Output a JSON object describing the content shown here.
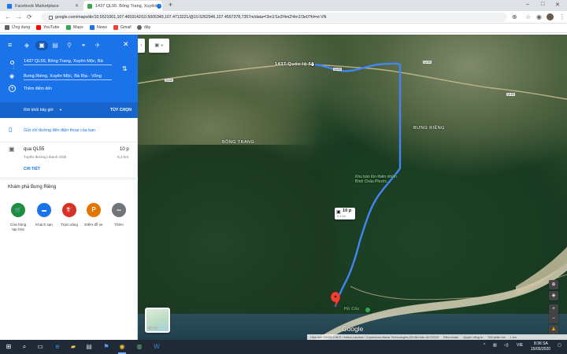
{
  "browser": {
    "tabs": [
      {
        "title": "Facebook Marketplace",
        "active": false,
        "favicon_color": "#1877f2"
      },
      {
        "title": "1437 QL55, Bông Trang, Xuyên M",
        "active": true,
        "favicon_color": "#34a853"
      },
      {
        "title": "",
        "active": false,
        "favicon_color": "#1a73e8"
      }
    ],
    "new_tab": "+",
    "window_controls": [
      "–",
      "□",
      "✕"
    ],
    "url": "google.com/maps/dir/10.5521001,107.4659142/10.5005349,107.4713221/@10.5262946,107.4597378,7357m/data=!3m1!1e3!4m2!4m1!3e0?hl=vi-VN",
    "bookmarks": [
      {
        "label": "Ứng dụng",
        "icon": "apps-grid-icon",
        "color": "#5f6368"
      },
      {
        "label": "YouTube",
        "icon": "youtube-icon",
        "color": "#ff0000"
      },
      {
        "label": "Maps",
        "icon": "maps-icon",
        "color": "#34a853"
      },
      {
        "label": "News",
        "icon": "news-icon",
        "color": "#1a73e8"
      },
      {
        "label": "Gmail",
        "icon": "gmail-icon",
        "color": "#ea4335"
      },
      {
        "label": "đây",
        "icon": "globe-icon",
        "color": "#5f6368"
      }
    ]
  },
  "directions": {
    "origin": "1437 QL55, Bông Trang, Xuyên Mộc, Bà",
    "destination": "Bưng Riềng, Xuyên Mộc, Bà Rịa - Vũng",
    "add_destination": "Thêm điểm đến",
    "leave_now": "Rời khỏi bây giờ",
    "options": "TÙY CHỌN",
    "send_to_phone": "Gửi chỉ đường đến điện thoại của bạn",
    "route": {
      "via": "qua QL55",
      "duration": "10 p",
      "note": "Tuyến đường nhanh nhất",
      "distance": "6,3 km",
      "details": "CHI TIẾT"
    },
    "explore_title": "Khám phá Bưng Riềng",
    "explore": [
      {
        "label": "Cửa hàng tạp hóa",
        "color": "#1e8e3e",
        "glyph": "🛒",
        "icon": "grocery-cart-icon"
      },
      {
        "label": "Khách sạn",
        "color": "#1a73e8",
        "glyph": "▬",
        "icon": "hotel-bed-icon"
      },
      {
        "label": "Trạm xăng",
        "color": "#d93025",
        "glyph": "⛽",
        "icon": "gas-station-icon"
      },
      {
        "label": "Điểm đỗ xe",
        "color": "#e37400",
        "glyph": "P",
        "icon": "parking-icon"
      },
      {
        "label": "Thêm",
        "color": "#70757a",
        "glyph": "•••",
        "icon": "more-dots-icon"
      }
    ]
  },
  "map": {
    "labels": {
      "origin": "1437 Quốc lộ 55",
      "area_left": "BÔNG TRANG",
      "area_right": "BƯNG RIỀNG",
      "reserve": "Khu bảo tồn thiên nhiên Bình Châu Phước...",
      "poi": "Hồ Cốc",
      "road_badge_1": "QL55",
      "road_badge_2": "QL55",
      "road_badge_3": "QL55",
      "road_badge_4": "QL55"
    },
    "route_bubble": {
      "duration": "10 p",
      "distance": "6,3 km"
    },
    "layer_label": "Bản đồ",
    "google": "Google",
    "footer": [
      "Hình ảnh ©2020 CNES / Airbus,Landsat / Copernicus,Maxar Technologies,Dữ liệu bản đồ ©2020",
      "Điều khoản",
      "Quyền riêng tư",
      "Gửi phản hồi",
      "1 km"
    ],
    "travel_mode_selected": "car",
    "colors": {
      "route": "#4285f4",
      "accent": "#1a73e8"
    }
  },
  "taskbar": {
    "time": "8:36 SA",
    "date": "15/05/2020",
    "lang": "VIE"
  }
}
